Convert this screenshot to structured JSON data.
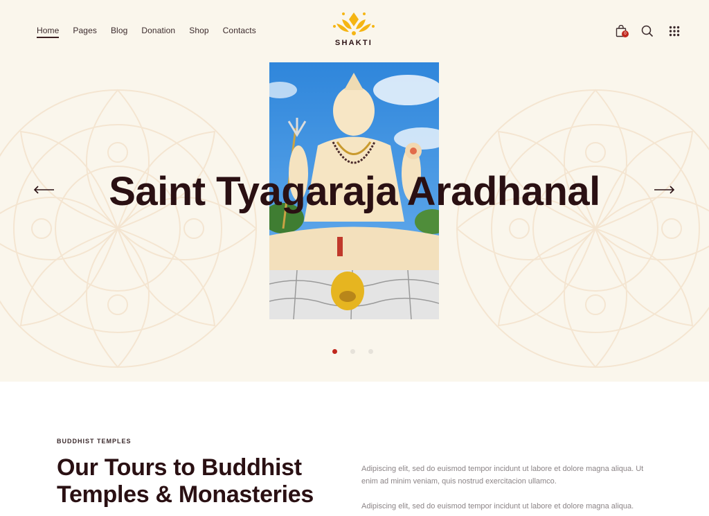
{
  "brand": {
    "name": "SHAKTI",
    "logo_icon": "lotus-icon",
    "accent": "#f5b514"
  },
  "nav": {
    "items": [
      {
        "label": "Home",
        "active": true
      },
      {
        "label": "Pages",
        "active": false
      },
      {
        "label": "Blog",
        "active": false
      },
      {
        "label": "Donation",
        "active": false
      },
      {
        "label": "Shop",
        "active": false
      },
      {
        "label": "Contacts",
        "active": false
      }
    ]
  },
  "header_icons": {
    "cart": {
      "icon": "shopping-bag-icon",
      "count": "0"
    },
    "search": {
      "icon": "search-icon"
    },
    "menu": {
      "icon": "grid-menu-icon"
    }
  },
  "slider": {
    "title": "Saint Tyagaraja Aradhanal",
    "image_alt": "Shiva statue against blue sky",
    "prev_icon": "arrow-left-icon",
    "next_icon": "arrow-right-icon",
    "total_slides": 3,
    "active_slide": 1
  },
  "section": {
    "eyebrow": "BUDDHIST TEMPLES",
    "title": "Our Tours to Buddhist Temples & Monasteries",
    "paragraphs": [
      "Adipiscing elit, sed do euismod tempor incidunt ut labore et dolore magna aliqua. Ut enim ad minim veniam, quis nostrud exercitacion ullamco.",
      "Adipiscing elit, sed do euismod tempor incidunt ut labore et dolore magna aliqua."
    ]
  },
  "colors": {
    "hero_bg": "#faf6ec",
    "text_dark": "#2a1013",
    "active_dot": "#c0281e",
    "badge": "#c0281e",
    "body_text": "#8b8486"
  }
}
